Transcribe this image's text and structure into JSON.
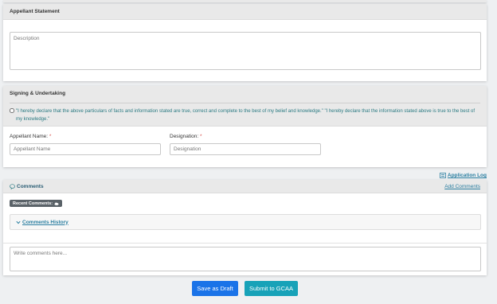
{
  "appellant_statement": {
    "title": "Appellant Statement",
    "description_placeholder": "Description"
  },
  "signing": {
    "title": "Signing & Undertaking",
    "declaration": "\"I hereby declare that the above particulars of facts and information stated are true, correct and complete to the best of my belief and knowledge.\" \"I hereby declare that the information stated above is true to the best of my knowledge.\"",
    "appellant_name_label": "Appellant Name:",
    "appellant_name_placeholder": "Appellant Name",
    "designation_label": "Designation:",
    "designation_placeholder": "Designation",
    "required_marker": "*"
  },
  "application_log_link": "Application Log",
  "comments": {
    "title": "Comments",
    "add_comments_link": "Add Comments",
    "recent_badge": "Recent Comments:",
    "history_link": "Comments History",
    "write_placeholder": "Write comments here..."
  },
  "actions": {
    "save_draft": "Save as Draft",
    "submit": "Submit to GCAA",
    "save_color": "#1a73e8",
    "submit_color": "#17a2b8"
  }
}
